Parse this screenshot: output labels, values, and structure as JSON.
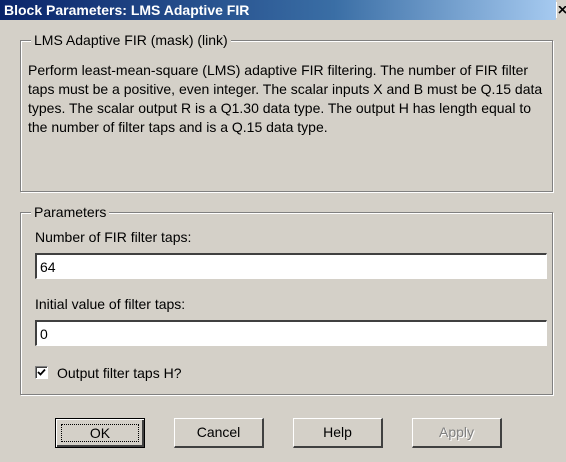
{
  "window": {
    "title": "Block Parameters: LMS Adaptive FIR",
    "close_icon": "close-x-icon"
  },
  "mask": {
    "legend": "LMS Adaptive FIR (mask) (link)",
    "description": "Perform least-mean-square (LMS) adaptive FIR filtering. The number of FIR filter taps must be a positive, even integer. The scalar inputs X and B must be Q.15 data types. The scalar output R is a Q1.30 data type. The output H has length equal to the number of filter taps and is a Q.15 data type."
  },
  "parameters": {
    "legend": "Parameters",
    "num_taps_label": "Number of FIR filter taps:",
    "num_taps_value": "64",
    "initial_value_label": "Initial value of filter taps:",
    "initial_value_value": "0",
    "output_taps_label": "Output filter taps H?",
    "output_taps_checked": true
  },
  "buttons": {
    "ok": "OK",
    "cancel": "Cancel",
    "help": "Help",
    "apply": "Apply",
    "apply_enabled": false
  }
}
